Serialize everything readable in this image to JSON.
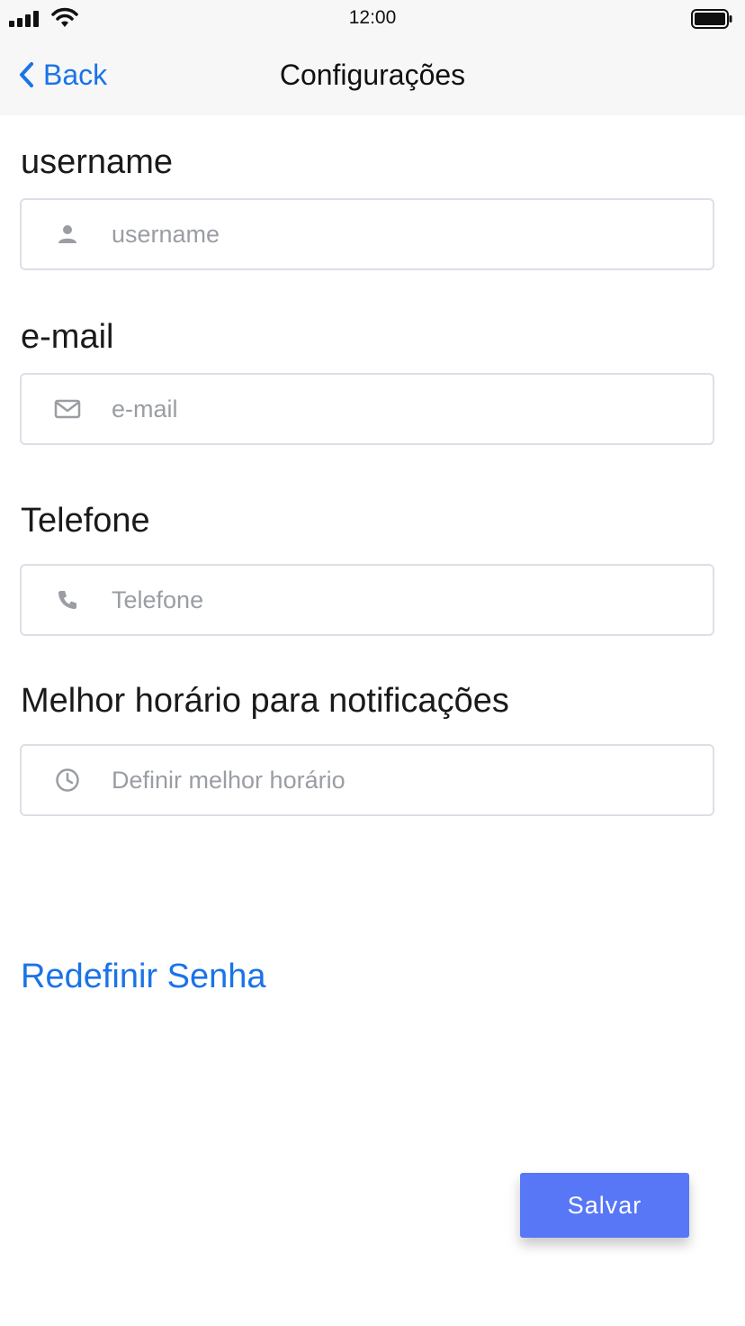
{
  "status_bar": {
    "time": "12:00"
  },
  "header": {
    "back_label": "Back",
    "title": "Configurações"
  },
  "form": {
    "username": {
      "label": "username",
      "placeholder": "username",
      "icon": "user-icon"
    },
    "email": {
      "label": "e-mail",
      "placeholder": "e-mail",
      "icon": "mail-icon"
    },
    "phone": {
      "label": "Telefone",
      "placeholder": "Telefone",
      "icon": "phone-icon"
    },
    "best_time": {
      "label": "Melhor horário para notificações",
      "placeholder": "Definir melhor horário",
      "icon": "clock-icon"
    }
  },
  "reset_password_label": "Redefinir Senha",
  "save_label": "Salvar",
  "colors": {
    "accent": "#1a73e8",
    "button": "#5877f6",
    "header_bg": "#f7f7f7",
    "icon_gray": "#9a9da3"
  }
}
